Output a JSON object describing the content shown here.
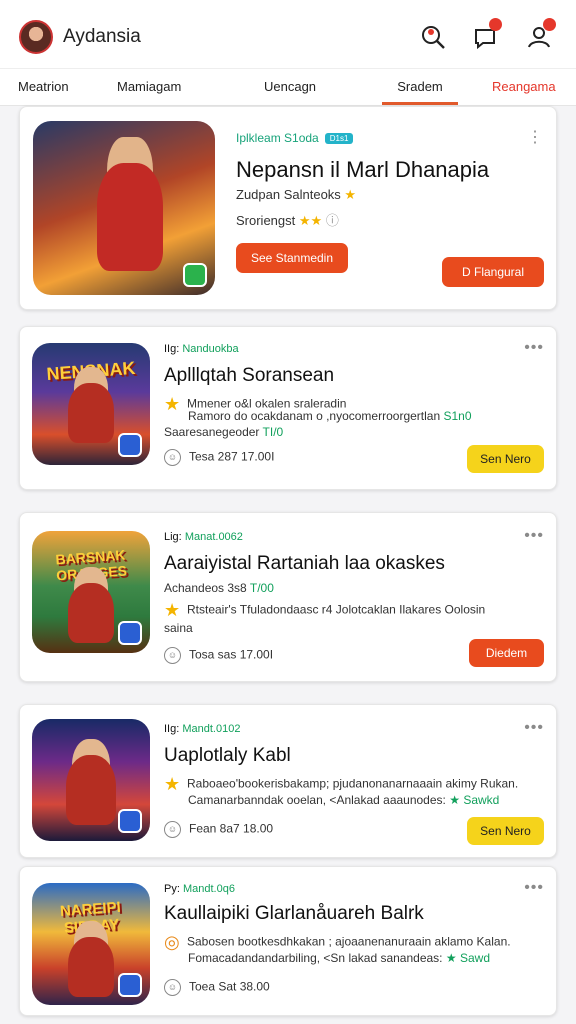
{
  "app": {
    "title": "Aydansia",
    "colors": {
      "accent": "#e25a2c",
      "orange_button": "#e84b1e",
      "yellow_button": "#f5d31b",
      "green_text": "#12a05c"
    }
  },
  "header_icons": [
    "search-icon",
    "chat-notification-icon",
    "user-notification-icon"
  ],
  "tabs": [
    "Meatrion",
    "Mamiagam",
    "Uencagn",
    "Sradem",
    "Reangama"
  ],
  "featured": {
    "meta": "Iplkleam S1oda",
    "chip": "D1s1",
    "title": "Nepansn il Marl Dhanapia",
    "line1": "Zudpan Salnteoks",
    "line2": "Sroriengst",
    "button_left": "See Stanmedin",
    "button_right": "D Flangural"
  },
  "cards": [
    {
      "prefix": "IIg:",
      "meta": "Nanduokba",
      "thumb_text": "NENSNAK",
      "title": "Aplllqtah Soransean",
      "line1": "Mmener o&l okalen sraleradin",
      "line2": "Ramoro do ocakdanam o ,nyocomerroorgertlan",
      "line2_end": "S1n0",
      "line3": "Saaresanegeoder",
      "line3_end": "TI/0",
      "date": "Tesa 287 17.00I",
      "button": "Sen Nero"
    },
    {
      "prefix": "Lig:",
      "meta": "Manat.0062",
      "thumb_text": "BARSNAK ORANGES",
      "title": "Aaraiyistal Rartaniah laa okaskes",
      "line1": "Achandeos 3s8",
      "line1_end": "T/00",
      "line2": "Rtsteair's Tfuladondaasc r4 Jolotcaklan Ilakares Oolosin",
      "line3": "saina",
      "date": "Tosa sas 17.00I",
      "button": "Diedem"
    },
    {
      "prefix": "IIg:",
      "meta": "Mandt.0102",
      "thumb_text": "",
      "title": "Uaplotlaly Kabl",
      "line1": "Raboaeo'bookerisbakamp; pjudanonanarnaaain akimy Rukan.",
      "line2": "Camanarbanndak ooelan, <Anlakad aaaunodes:",
      "line2_end": "Sawkd",
      "date": "Fean 8a7 18.00",
      "button": "Sen Nero"
    },
    {
      "prefix": "Py:",
      "meta": "Mandt.0q6",
      "thumb_text": "NAREIPI SIDDAY",
      "title": "Kaullaipiki Glarlanåuareh Balrk",
      "line1": "Sabosen bootkesdhkakan ; ajoaanenanuraain aklamo Kalan.",
      "line2": "Fomacadandandarbiling, <Sn lakad sanandeas:",
      "line2_end": "Sawd",
      "date": "Toea Sat 38.00",
      "button": ""
    }
  ]
}
